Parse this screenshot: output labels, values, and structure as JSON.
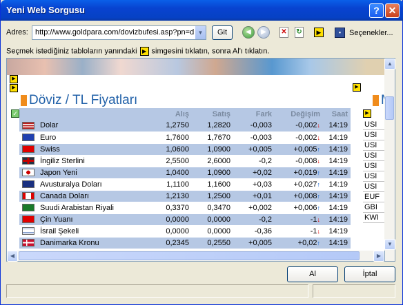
{
  "window": {
    "title": "Yeni Web Sorgusu",
    "help_glyph": "?",
    "close_glyph": "✕"
  },
  "toolbar": {
    "address_label": "Adres:",
    "address_value": "http://www.goldpara.com/dovizbufesi.asp?pn=d",
    "go_label": "Git",
    "options_label": "Seçenekler..."
  },
  "instruction": {
    "part1": "Seçmek istediğiniz tabloların yanındaki",
    "part2": "simgesini tıklatın, sonra Al'ı tıklatın."
  },
  "section": {
    "title": "Döviz / TL Fiyatları",
    "right_title": "M"
  },
  "table": {
    "headers": [
      "",
      "Alış",
      "Satış",
      "Fark",
      "Değişim",
      "Saat"
    ],
    "rows": [
      {
        "flag": "us",
        "name": "Dolar",
        "alis": "1,2750",
        "satis": "1,2820",
        "fark": "-0,003",
        "degisim": "-0,002",
        "dir": "down",
        "saat": "14:19"
      },
      {
        "flag": "eu",
        "name": "Euro",
        "alis": "1,7600",
        "satis": "1,7670",
        "fark": "-0,003",
        "degisim": "-0,002",
        "dir": "down",
        "saat": "14:19"
      },
      {
        "flag": "ch",
        "name": "Swiss",
        "alis": "1,0600",
        "satis": "1,0900",
        "fark": "+0,005",
        "degisim": "+0,005",
        "dir": "up",
        "saat": "14:19"
      },
      {
        "flag": "gb",
        "name": "İngiliz Sterlini",
        "alis": "2,5500",
        "satis": "2,6000",
        "fark": "-0,2",
        "degisim": "-0,008",
        "dir": "down",
        "saat": "14:19"
      },
      {
        "flag": "jp",
        "name": "Japon Yeni",
        "alis": "1,0400",
        "satis": "1,0900",
        "fark": "+0,02",
        "degisim": "+0,019",
        "dir": "up",
        "saat": "14:19"
      },
      {
        "flag": "au",
        "name": "Avusturalya Doları",
        "alis": "1,1100",
        "satis": "1,1600",
        "fark": "+0,03",
        "degisim": "+0,027",
        "dir": "up",
        "saat": "14:19"
      },
      {
        "flag": "ca",
        "name": "Canada Doları",
        "alis": "1,2130",
        "satis": "1,2500",
        "fark": "+0,01",
        "degisim": "+0,008",
        "dir": "up",
        "saat": "14:19"
      },
      {
        "flag": "sa",
        "name": "Suudi Arabistan Riyali",
        "alis": "0,3370",
        "satis": "0,3470",
        "fark": "+0,002",
        "degisim": "+0,006",
        "dir": "up",
        "saat": "14:19"
      },
      {
        "flag": "cn",
        "name": "Çin Yuanı",
        "alis": "0,0000",
        "satis": "0,0000",
        "fark": "-0,2",
        "degisim": "-1",
        "dir": "down",
        "saat": "14:19"
      },
      {
        "flag": "il",
        "name": "İsrail Şekeli",
        "alis": "0,0000",
        "satis": "0,0000",
        "fark": "-0,36",
        "degisim": "-1",
        "dir": "down",
        "saat": "14:19"
      },
      {
        "flag": "dk",
        "name": "Danimarka Kronu",
        "alis": "0,2345",
        "satis": "0,2550",
        "fark": "+0,005",
        "degisim": "+0,02",
        "dir": "up",
        "saat": "14:19"
      }
    ]
  },
  "side_list": [
    "USI",
    "USI",
    "USI",
    "USI",
    "USI",
    "USI",
    "USI",
    "EUF",
    "GBI",
    "KWI"
  ],
  "buttons": {
    "ok_label": "Al",
    "cancel_label": "İptal"
  },
  "colors": {
    "title_bar": "#0843d0",
    "row_alt": "#b6c8e4",
    "section_title": "#2060a8",
    "down_arrow": "#e00000",
    "up_arrow": "#1060d0"
  }
}
